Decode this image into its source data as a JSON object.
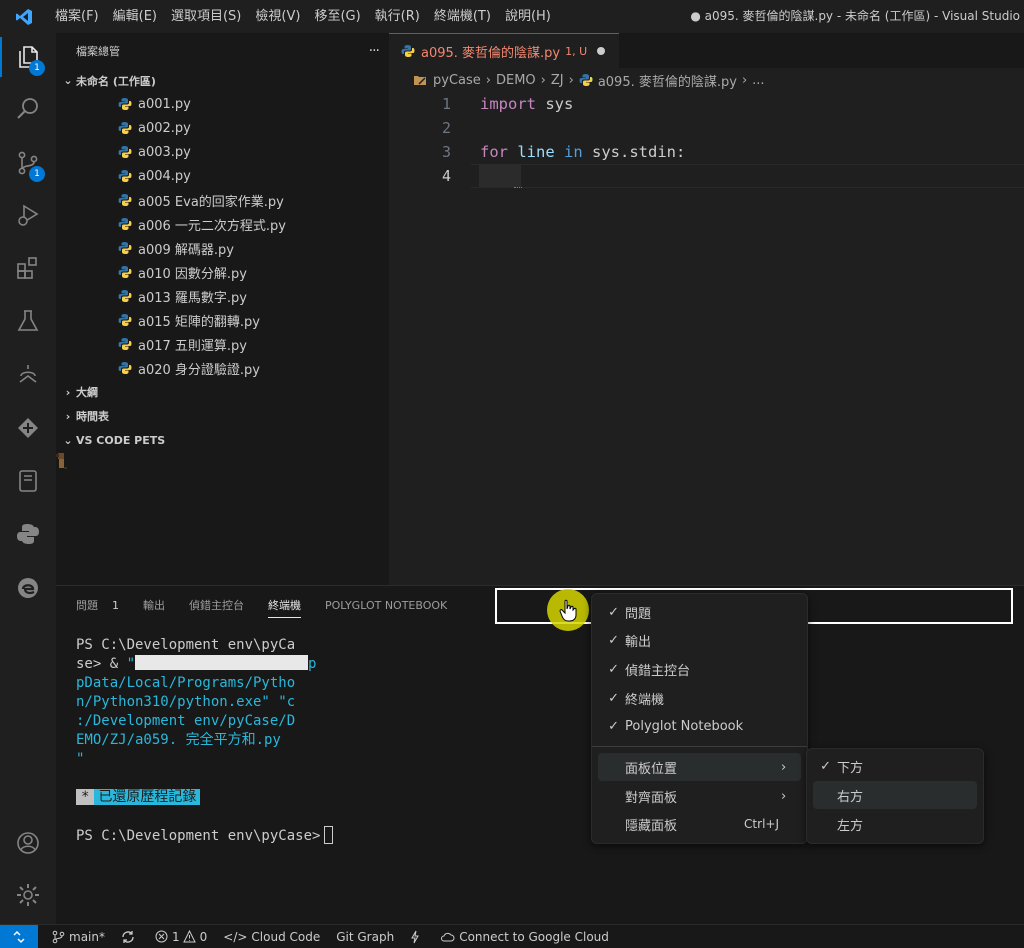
{
  "titlebar": {
    "menus": [
      "檔案(F)",
      "編輯(E)",
      "選取項目(S)",
      "檢視(V)",
      "移至(G)",
      "執行(R)",
      "終端機(T)",
      "說明(H)"
    ],
    "window_title": "● a095. 麥哲倫的陰謀.py - 未命名 (工作區) - Visual Studio"
  },
  "activitybar": {
    "explorer_badge": "1",
    "scm_badge": "1",
    "icons": [
      "files-icon",
      "search-icon",
      "source-control-icon",
      "run-debug-icon",
      "extensions-icon",
      "testing-icon",
      "remote-icon",
      "git-graph-icon",
      "notebook-icon",
      "python-icon",
      "edge-icon",
      "account-icon",
      "settings-gear-icon"
    ]
  },
  "sidebar": {
    "header": "檔案總管",
    "more": "···",
    "workspace": "未命名 (工作區)",
    "files": [
      "a001.py",
      "a002.py",
      "a003.py",
      "a004.py",
      "a005 Eva的回家作業.py",
      "a006 一元二次方程式.py",
      "a009 解碼器.py",
      "a010 因數分解.py",
      "a013 羅馬數字.py",
      "a015 矩陣的翻轉.py",
      "a017 五則運算.py",
      "a020 身分證驗證.py"
    ],
    "sections": [
      "大綱",
      "時間表",
      "VS CODE PETS"
    ]
  },
  "editor": {
    "tab_name": "a095. 麥哲倫的陰謀.py",
    "tab_status": "1, U",
    "breadcrumb": [
      "pyCase",
      "DEMO",
      "ZJ",
      "a095. 麥哲倫的陰謀.py",
      "..."
    ],
    "line_numbers": [
      "1",
      "2",
      "3",
      "4"
    ],
    "code": {
      "l1_kw": "import",
      "l1_rest": " sys",
      "l3_kw1": "for",
      "l3_var": " line ",
      "l3_kw2": "in",
      "l3_rest": " sys.stdin:"
    }
  },
  "panel": {
    "tabs": {
      "problems": "問題",
      "problems_count": "1",
      "output": "輸出",
      "debug": "偵錯主控台",
      "terminal": "終端機",
      "polyglot": "POLYGLOT NOTEBOOK"
    },
    "terminal": {
      "l1": "PS C:\\Development env\\pyCa",
      "l2_a": "se> & ",
      "l2_b": "\"",
      "l2_c": "p",
      "l3": "pData/Local/Programs/Pytho",
      "l4": "n/Python310/python.exe\" \"c",
      "l5": ":/Development env/pyCase/D",
      "l6": "EMO/ZJ/a059. 完全平方和.py",
      "l7": "\"",
      "restored_star": "*",
      "restored_msg": "已還原歷程記錄",
      "prompt": "PS C:\\Development env\\pyCase>"
    }
  },
  "context_menu": {
    "items": [
      {
        "label": "問題",
        "checked": "✓"
      },
      {
        "label": "輸出",
        "checked": "✓"
      },
      {
        "label": "偵錯主控台",
        "checked": "✓"
      },
      {
        "label": "終端機",
        "checked": "✓"
      },
      {
        "label": "Polyglot Notebook",
        "checked": "✓"
      }
    ],
    "panel_position": "面板位置",
    "align_panel": "對齊面板",
    "hide_panel": "隱藏面板",
    "hide_shortcut": "Ctrl+J",
    "submenu": {
      "bottom": "下方",
      "bottom_check": "✓",
      "right": "右方",
      "left": "左方"
    }
  },
  "statusbar": {
    "branch": "main*",
    "errors": "1",
    "warnings": "0",
    "cloud_code": "Cloud Code",
    "git_graph": "Git Graph",
    "google_cloud": "Connect to Google Cloud"
  },
  "colors": {
    "accent": "#0078d4",
    "keyword_purple": "#c586c0",
    "keyword_blue": "#569cd6",
    "terminal_cyan": "#29b8db",
    "modified_tab": "#f48771",
    "mouse_halo": "#d6d600"
  }
}
